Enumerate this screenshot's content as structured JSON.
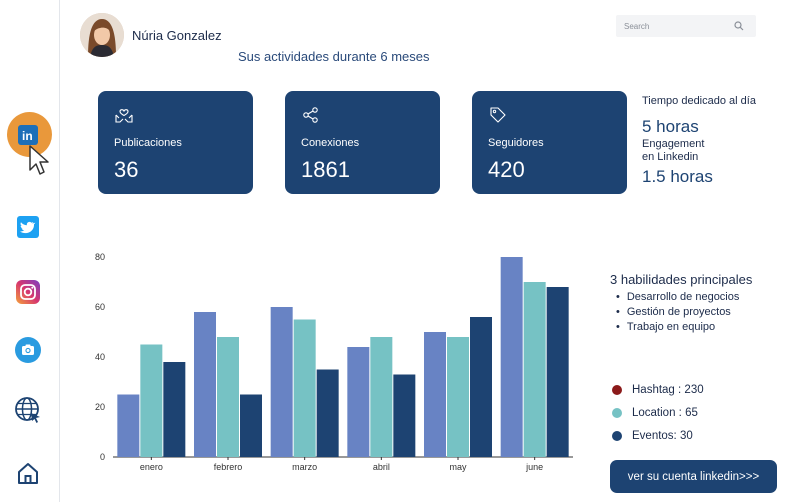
{
  "profile": {
    "name": "Núria Gonzalez"
  },
  "subtitle": "Sus actividades durante 6 meses",
  "search": {
    "placeholder": "Search"
  },
  "sidebar": {
    "items": [
      {
        "icon": "linkedin-icon",
        "glyph": "in",
        "color": "#1d6fb8",
        "active": true
      },
      {
        "icon": "twitter-icon",
        "color": "#1da1f2"
      },
      {
        "icon": "instagram-icon",
        "color": "#d6366f"
      },
      {
        "icon": "camera-icon",
        "color": "#2a9be0"
      },
      {
        "icon": "globe-icon",
        "color": "#1d4372"
      },
      {
        "icon": "home-icon",
        "color": "#1d4372"
      }
    ],
    "active_color": "#e9983b"
  },
  "cards": [
    {
      "icon": "hands-heart-icon",
      "label": "Publicaciones",
      "value": "36"
    },
    {
      "icon": "share-icon",
      "label": "Conexiones",
      "value": "1861"
    },
    {
      "icon": "tag-icon",
      "label": "Seguidores",
      "value": "420"
    }
  ],
  "time": {
    "label": "Tiempo dedicado al día",
    "value": "5 horas",
    "engagement_label_1": "Engagement",
    "engagement_label_2": "en Linkedin",
    "engagement_value": "1.5 horas"
  },
  "skills": {
    "title": "3 habilidades principales",
    "items": [
      "Desarrollo de negocios",
      "Gestión de proyectos",
      "Trabajo en equipo"
    ]
  },
  "legend": [
    {
      "label": "Hashtag : 230",
      "color": "#8b1a1a"
    },
    {
      "label": "Location : 65",
      "color": "#76c2c4"
    },
    {
      "label": "Eventos: 30",
      "color": "#1d4372"
    }
  ],
  "cta": "ver su cuenta linkedin>>>",
  "chart_data": {
    "type": "bar",
    "categories": [
      "enero",
      "febrero",
      "marzo",
      "abril",
      "may",
      "june"
    ],
    "series": [
      {
        "values": [
          25,
          58,
          60,
          44,
          50,
          80
        ],
        "color": "#6883c4"
      },
      {
        "values": [
          45,
          48,
          55,
          48,
          48,
          70
        ],
        "color": "#76c2c4"
      },
      {
        "values": [
          38,
          25,
          35,
          33,
          56,
          68
        ],
        "color": "#1d4372"
      }
    ],
    "ylim": [
      0,
      80
    ],
    "yticks": [
      0,
      20,
      40,
      60,
      80
    ],
    "grid": false
  }
}
